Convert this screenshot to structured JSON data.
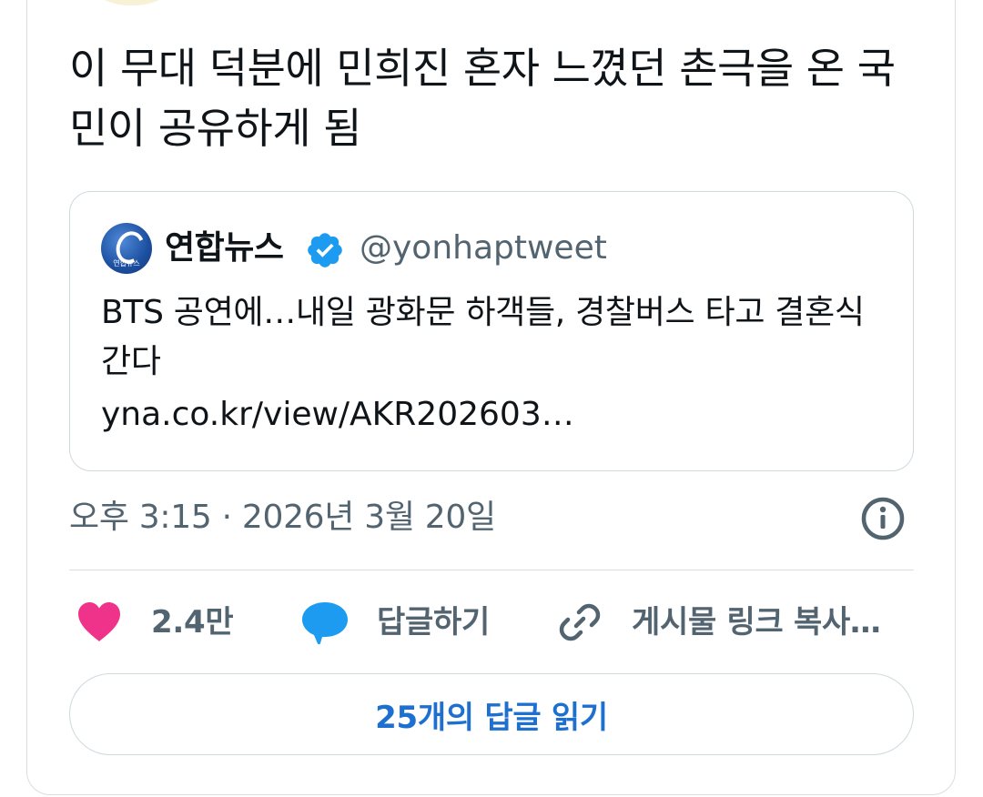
{
  "tweet": {
    "text": "이 무대 덕분에 민희진 혼자 느꼈던 촌극을 온 국민이 공유하게 됨",
    "timestamp": "오후 3:15 · 2026년 3월 20일"
  },
  "quote": {
    "logo_text": "연합뉴스",
    "display_name": "연합뉴스",
    "handle": "@yonhaptweet",
    "body": "BTS 공연에…내일 광화문 하객들, 경찰버스 타고 결혼식 간다",
    "link": "yna.co.kr/view/AKR202603…"
  },
  "actions": {
    "like_count": "2.4만",
    "reply_label": "답글하기",
    "copy_link_label": "게시물 링크 복사…"
  },
  "read_replies_label": "25개의 답글 읽기",
  "icons": {
    "heart": "heart-icon",
    "reply": "speech-bubble-icon",
    "link": "link-icon",
    "info": "info-icon",
    "verified": "verified-badge-icon"
  },
  "colors": {
    "heart": "#f0338a",
    "reply_bubble": "#1d9bf0",
    "verified": "#1d9bf0",
    "accent_text": "#1d6fd0",
    "secondary_text": "#536471"
  }
}
